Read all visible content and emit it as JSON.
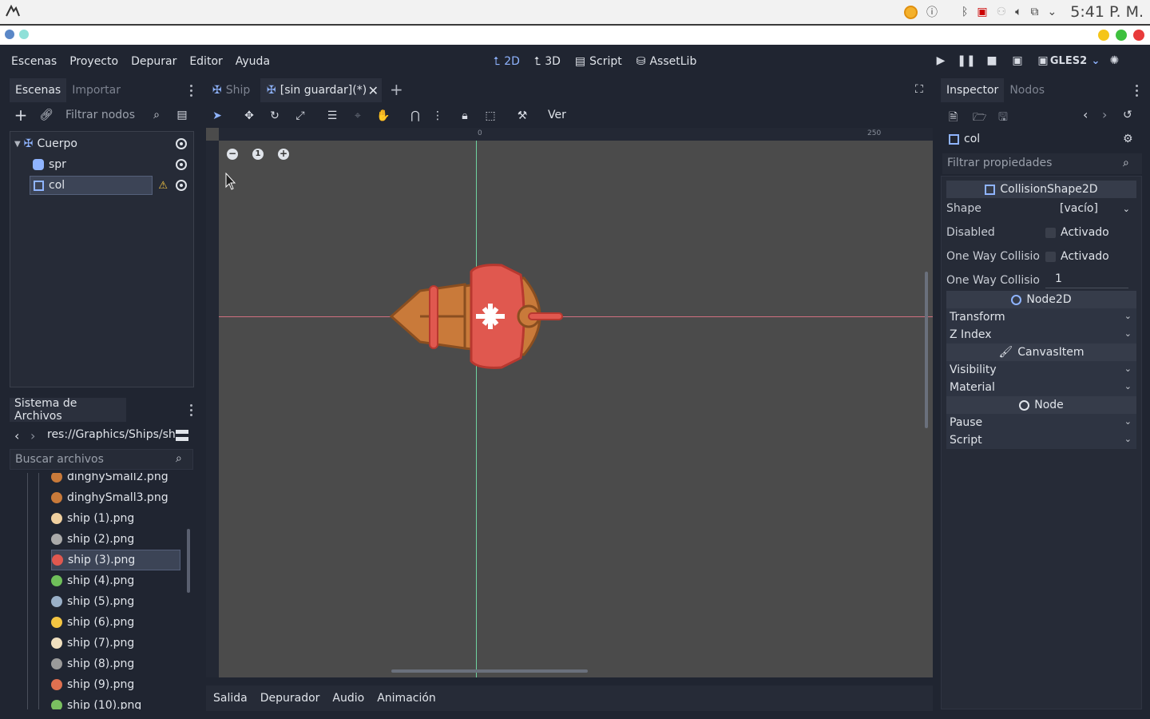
{
  "system": {
    "clock": "5:41 P. M."
  },
  "menu": {
    "items": [
      "Escenas",
      "Proyecto",
      "Depurar",
      "Editor",
      "Ayuda"
    ]
  },
  "modes": {
    "m2d": "2D",
    "m3d": "3D",
    "script": "Script",
    "assetlib": "AssetLib"
  },
  "renderer": "GLES2",
  "scene_panel": {
    "tabs": [
      "Escenas",
      "Importar"
    ],
    "filter_placeholder": "Filtrar nodos",
    "nodes": [
      {
        "label": "Cuerpo"
      },
      {
        "label": "spr"
      },
      {
        "label": "col"
      }
    ]
  },
  "filesystem": {
    "title": "Sistema de Archivos",
    "path": "res://Graphics/Ships/sh",
    "search_placeholder": "Buscar archivos",
    "files": [
      "dinghySmall2.png",
      "dinghySmall3.png",
      "ship (1).png",
      "ship (2).png",
      "ship (3).png",
      "ship (4).png",
      "ship (5).png",
      "ship (6).png",
      "ship (7).png",
      "ship (8).png",
      "ship (9).png",
      "ship (10).png"
    ],
    "selected_file": "ship (3).png"
  },
  "editor": {
    "tabs": [
      "Ship",
      "[sin guardar](*)"
    ],
    "view_label": "Ver",
    "ruler_marks": [
      "0",
      "250"
    ]
  },
  "bottom_tabs": [
    "Salida",
    "Depurador",
    "Audio",
    "Animación"
  ],
  "inspector": {
    "tabs": [
      "Inspector",
      "Nodos"
    ],
    "node_name": "col",
    "filter_placeholder": "Filtrar propiedades",
    "sections": {
      "collision": "CollisionShape2D",
      "node2d": "Node2D",
      "canvasitem": "CanvasItem",
      "node": "Node"
    },
    "props": {
      "shape_label": "Shape",
      "shape_value": "[vacío]",
      "disabled_label": "Disabled",
      "disabled_value": "Activado",
      "oneway_label": "One Way Collisio",
      "oneway_value": "Activado",
      "oneway_margin_label": "One Way Collisio",
      "oneway_margin_value": "1"
    },
    "groups": {
      "transform": "Transform",
      "zindex": "Z Index",
      "visibility": "Visibility",
      "material": "Material",
      "pause": "Pause",
      "script": "Script"
    }
  },
  "colors": {
    "accent": "#8fb4ff",
    "bg": "#202531",
    "viewport": "#4b4b4b",
    "ship_red": "#e0584f",
    "ship_wood": "#c97a3a"
  }
}
